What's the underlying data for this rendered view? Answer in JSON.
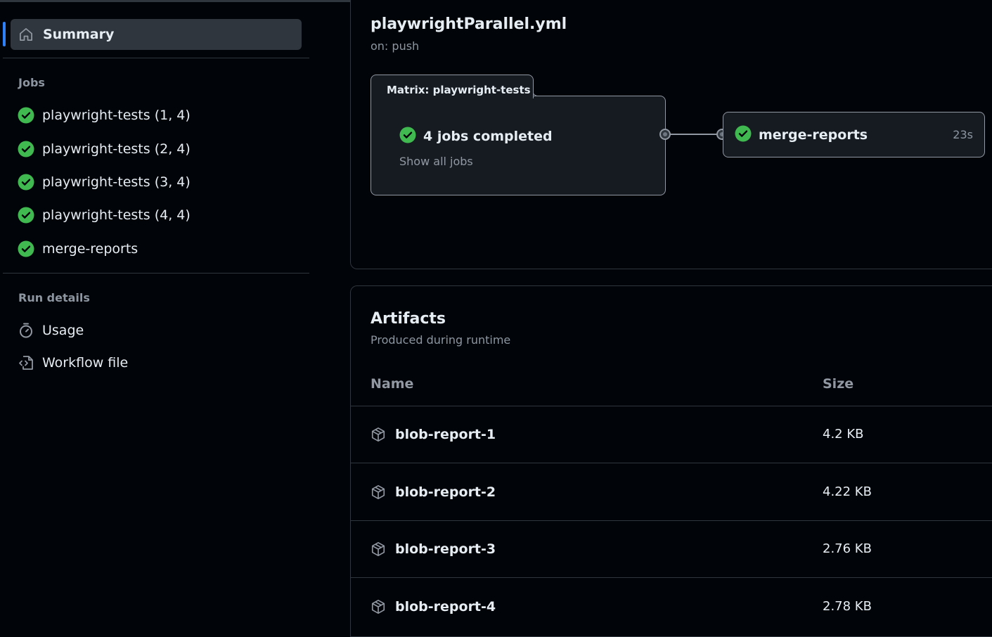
{
  "sidebar": {
    "summary_label": "Summary",
    "jobs_heading": "Jobs",
    "jobs": [
      {
        "label": "playwright-tests (1, 4)",
        "status": "success"
      },
      {
        "label": "playwright-tests (2, 4)",
        "status": "success"
      },
      {
        "label": "playwright-tests (3, 4)",
        "status": "success"
      },
      {
        "label": "playwright-tests (4, 4)",
        "status": "success"
      },
      {
        "label": "merge-reports",
        "status": "success"
      }
    ],
    "run_details_heading": "Run details",
    "usage_label": "Usage",
    "workflow_file_label": "Workflow file"
  },
  "workflow": {
    "filename": "playwrightParallel.yml",
    "trigger": "on: push",
    "matrix": {
      "title": "Matrix: playwright-tests",
      "status_text": "4 jobs completed",
      "show_all_label": "Show all jobs"
    },
    "merge_job": {
      "label": "merge-reports",
      "duration": "23s"
    }
  },
  "artifacts": {
    "title": "Artifacts",
    "subtitle": "Produced during runtime",
    "col_name": "Name",
    "col_size": "Size",
    "rows": [
      {
        "name": "blob-report-1",
        "size": "4.2 KB"
      },
      {
        "name": "blob-report-2",
        "size": "4.22 KB"
      },
      {
        "name": "blob-report-3",
        "size": "2.76 KB"
      },
      {
        "name": "blob-report-4",
        "size": "2.78 KB"
      }
    ]
  },
  "colors": {
    "success": "#3fb950",
    "accent": "#2f81f7",
    "background": "#010409",
    "panel": "#161b22",
    "border": "#30363d"
  }
}
